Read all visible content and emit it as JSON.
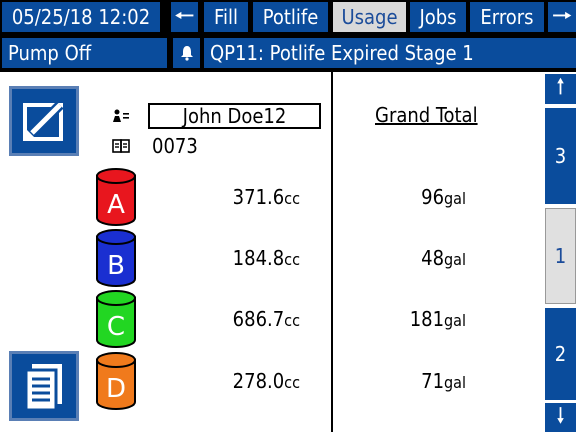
{
  "header": {
    "datetime": "05/25/18 12:02",
    "tabs": [
      {
        "label": "Fill"
      },
      {
        "label": "Potlife"
      },
      {
        "label": "Usage"
      },
      {
        "label": "Jobs"
      },
      {
        "label": "Errors"
      }
    ],
    "status": "Pump Off",
    "alarm_message": "QP11: Potlife Expired Stage 1"
  },
  "user": {
    "name": "John Doe12",
    "job_number": "0073"
  },
  "grand_total_label": "Grand Total",
  "materials": [
    {
      "letter": "A",
      "color": "#e8161e",
      "usage": "371.6",
      "usage_unit": "cc",
      "total": "96",
      "total_unit": "gal"
    },
    {
      "letter": "B",
      "color": "#1a2fd1",
      "usage": "184.8",
      "usage_unit": "cc",
      "total": "48",
      "total_unit": "gal"
    },
    {
      "letter": "C",
      "color": "#22d622",
      "usage": "686.7",
      "usage_unit": "cc",
      "total": "181",
      "total_unit": "gal"
    },
    {
      "letter": "D",
      "color": "#f07a1c",
      "usage": "278.0",
      "usage_unit": "cc",
      "total": "71",
      "total_unit": "gal"
    }
  ],
  "side_tabs": [
    {
      "label": "3"
    },
    {
      "label": "1"
    },
    {
      "label": "2"
    }
  ],
  "icons": {
    "prev": "arrow-left-icon",
    "next": "arrow-right-icon",
    "up": "arrow-up-icon",
    "down": "arrow-down-icon",
    "user": "user-icon",
    "job": "job-icon",
    "alarm": "bell-icon",
    "edit": "edit-icon",
    "report": "report-icon"
  }
}
